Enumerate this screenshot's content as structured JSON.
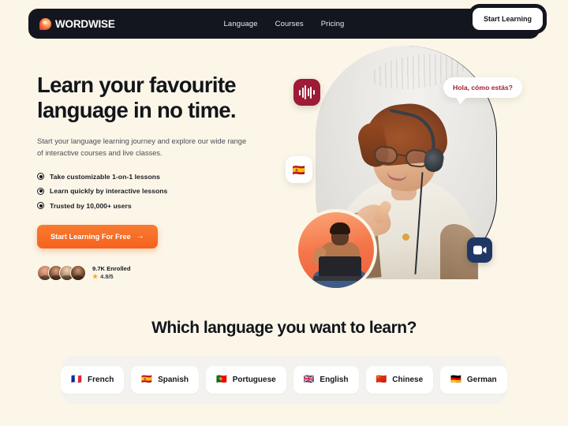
{
  "brand": {
    "name": "WORDWISE",
    "mark_icon": "speech-blob-logo-icon"
  },
  "nav": {
    "links": [
      {
        "label": "Language"
      },
      {
        "label": "Courses"
      },
      {
        "label": "Pricing"
      }
    ],
    "cta_label": "Start Learning"
  },
  "hero": {
    "title_line1": "Learn your favourite",
    "title_line2": "language in no time.",
    "subtitle": "Start your language learning journey and explore our wide range of interactive courses and live classes.",
    "bullets": [
      {
        "text": "Take customizable 1-on-1 lessons"
      },
      {
        "text": "Learn quickly by interactive lessons"
      },
      {
        "text": "Trusted by 10,000+ users"
      }
    ],
    "cta_label": "Start Learning For Free",
    "cta_arrow": "→",
    "social": {
      "enrolled": "9.7K Enrolled",
      "rating": "4.8/5",
      "star_icon": "★"
    },
    "art": {
      "speech_bubble": "Hola, cómo estás?",
      "audio_badge_icon": "audio-waveform-icon",
      "flag_badge_icon": "🇪🇸",
      "video_badge_icon": "video-camera-icon"
    }
  },
  "languages": {
    "heading": "Which language you want to learn?",
    "options": [
      {
        "flag": "🇫🇷",
        "label": "French"
      },
      {
        "flag": "🇪🇸",
        "label": "Spanish"
      },
      {
        "flag": "🇵🇹",
        "label": "Portuguese"
      },
      {
        "flag": "🇬🇧",
        "label": "English"
      },
      {
        "flag": "🇨🇳",
        "label": "Chinese"
      },
      {
        "flag": "🇩🇪",
        "label": "German"
      }
    ]
  },
  "colors": {
    "page_background": "#FCF6E8",
    "navbar": "#14161F",
    "accent_orange": "#F4621F",
    "speech_red": "#A41E2E",
    "audio_badge": "#9D1B36",
    "video_badge": "#1F3763"
  }
}
